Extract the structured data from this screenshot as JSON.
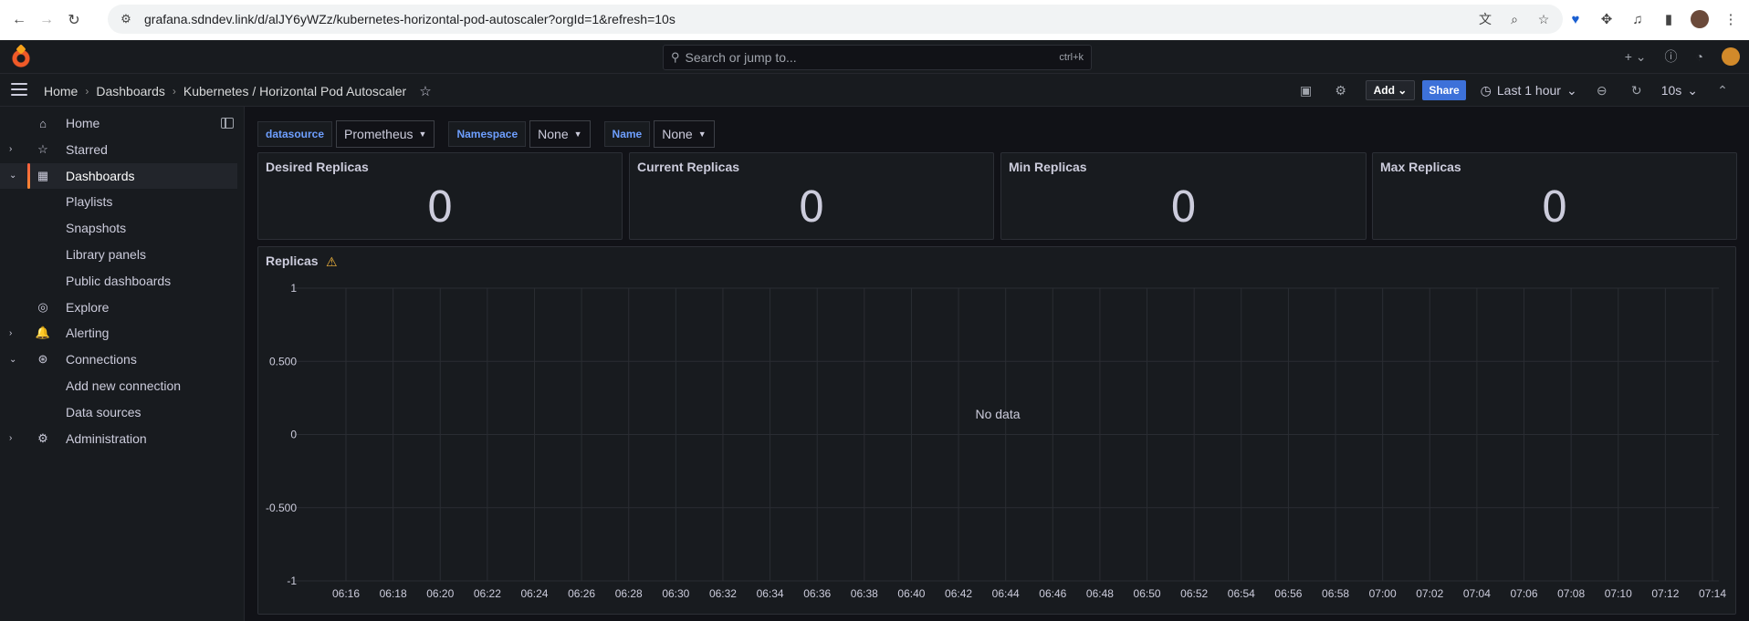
{
  "browser": {
    "url": "grafana.sdndev.link/d/alJY6yWZz/kubernetes-horizontal-pod-autoscaler?orgId=1&refresh=10s"
  },
  "topbar": {
    "search_placeholder": "Search or jump to...",
    "search_shortcut": "ctrl+k"
  },
  "breadcrumb": {
    "items": [
      "Home",
      "Dashboards",
      "Kubernetes / Horizontal Pod Autoscaler"
    ]
  },
  "toolbar": {
    "add_label": "Add",
    "share_label": "Share",
    "time_range": "Last 1 hour",
    "refresh_interval": "10s"
  },
  "sidebar": {
    "items": [
      {
        "label": "Home",
        "icon": "home-icon",
        "chevron": "",
        "indent": false
      },
      {
        "label": "Starred",
        "icon": "star-icon",
        "chevron": "›",
        "indent": false
      },
      {
        "label": "Dashboards",
        "icon": "apps-icon",
        "chevron": "⌄",
        "indent": false,
        "active": true
      },
      {
        "label": "Playlists",
        "indent": true
      },
      {
        "label": "Snapshots",
        "indent": true
      },
      {
        "label": "Library panels",
        "indent": true
      },
      {
        "label": "Public dashboards",
        "indent": true
      },
      {
        "label": "Explore",
        "icon": "compass-icon",
        "chevron": "",
        "indent": false
      },
      {
        "label": "Alerting",
        "icon": "bell-icon",
        "chevron": "›",
        "indent": false
      },
      {
        "label": "Connections",
        "icon": "connections-icon",
        "chevron": "⌄",
        "indent": false
      },
      {
        "label": "Add new connection",
        "indent": true
      },
      {
        "label": "Data sources",
        "indent": true
      },
      {
        "label": "Administration",
        "icon": "cog-icon",
        "chevron": "›",
        "indent": false
      }
    ]
  },
  "variables": [
    {
      "label": "datasource",
      "value": "Prometheus"
    },
    {
      "label": "Namespace",
      "value": "None"
    },
    {
      "label": "Name",
      "value": "None"
    }
  ],
  "stats": [
    {
      "title": "Desired Replicas",
      "value": "0"
    },
    {
      "title": "Current Replicas",
      "value": "0"
    },
    {
      "title": "Min Replicas",
      "value": "0"
    },
    {
      "title": "Max Replicas",
      "value": "0"
    }
  ],
  "chart_data": {
    "type": "line",
    "title": "Replicas",
    "message": "No data",
    "series": [],
    "yticks": [
      "1",
      "0.500",
      "0",
      "-0.500",
      "-1"
    ],
    "ylim": [
      -1,
      1
    ],
    "x": [
      "06:16",
      "06:18",
      "06:20",
      "06:22",
      "06:24",
      "06:26",
      "06:28",
      "06:30",
      "06:32",
      "06:34",
      "06:36",
      "06:38",
      "06:40",
      "06:42",
      "06:44",
      "06:46",
      "06:48",
      "06:50",
      "06:52",
      "06:54",
      "06:56",
      "06:58",
      "07:00",
      "07:02",
      "07:04",
      "07:06",
      "07:08",
      "07:10",
      "07:12",
      "07:14"
    ],
    "grid": true
  },
  "colors": {
    "accent": "#3d71d9",
    "warning": "#f5b73d",
    "active_bar": "#f55f3e"
  }
}
